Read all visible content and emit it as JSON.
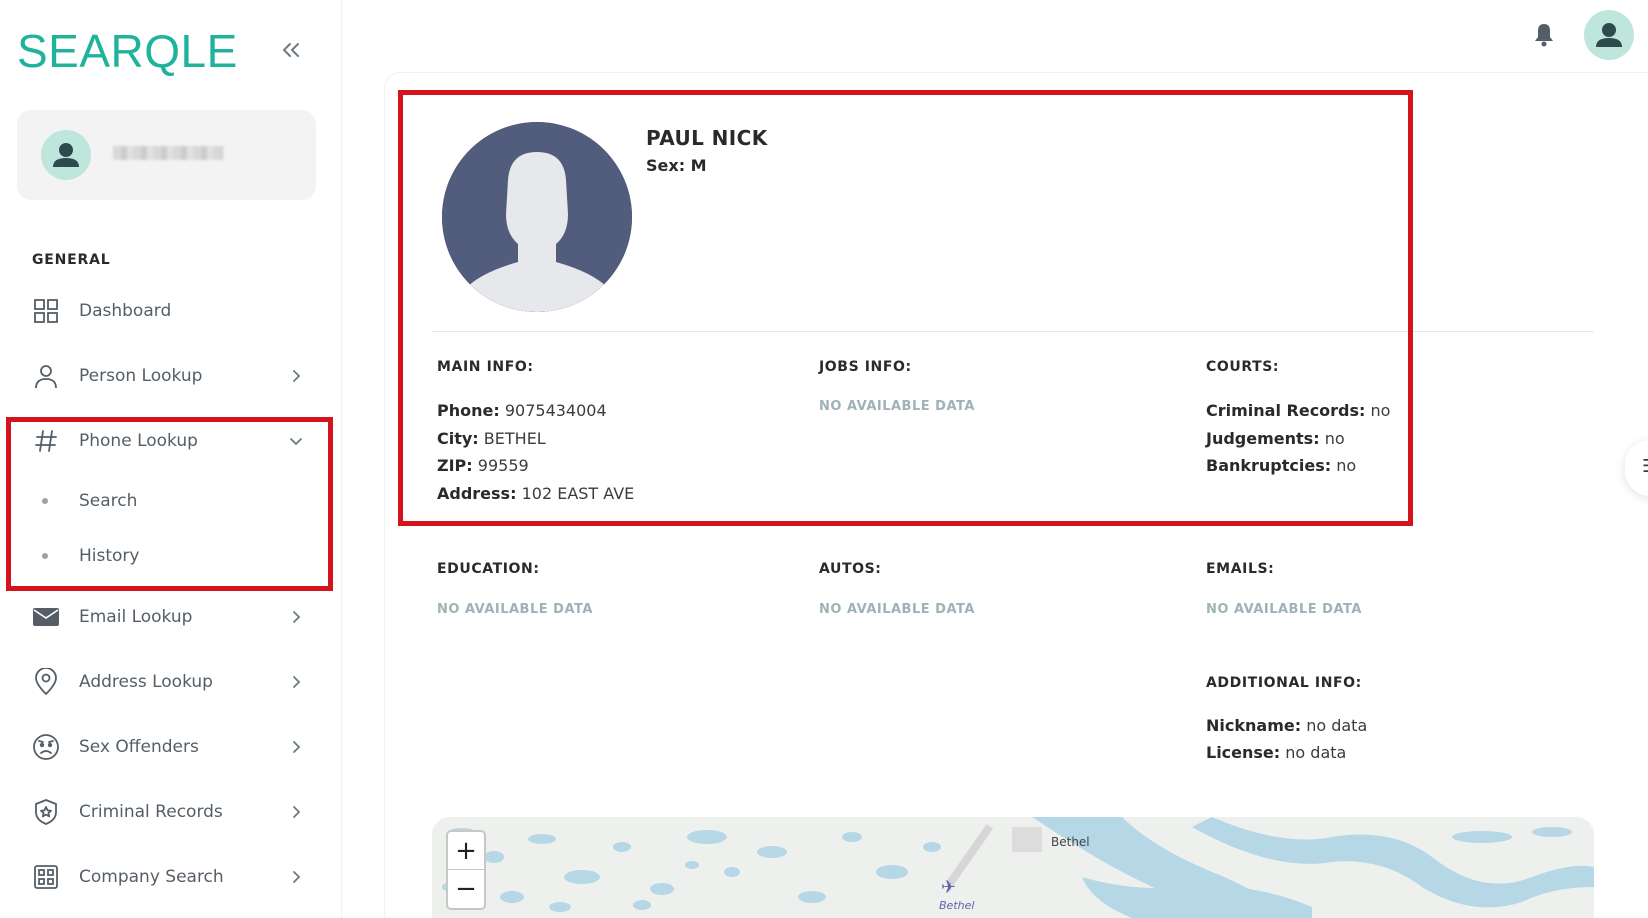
{
  "brand": {
    "logo": "SEARQLE",
    "accent": "#20b39b"
  },
  "sidebar": {
    "section_title": "GENERAL",
    "items": [
      {
        "label": "Dashboard",
        "icon": "grid-icon"
      },
      {
        "label": "Person Lookup",
        "icon": "person-icon"
      },
      {
        "label": "Phone Lookup",
        "icon": "hash-icon",
        "expanded": true,
        "subitems": [
          {
            "label": "Search"
          },
          {
            "label": "History"
          }
        ]
      },
      {
        "label": "Email Lookup",
        "icon": "envelope-icon"
      },
      {
        "label": "Address Lookup",
        "icon": "map-pin-icon"
      },
      {
        "label": "Sex Offenders",
        "icon": "face-icon"
      },
      {
        "label": "Criminal Records",
        "icon": "badge-icon"
      },
      {
        "label": "Company Search",
        "icon": "building-icon"
      }
    ]
  },
  "profile": {
    "name": "PAUL NICK",
    "sex_label": "Sex:",
    "sex_value": "M"
  },
  "main_info": {
    "title": "MAIN INFO:",
    "phone_label": "Phone:",
    "phone_value": "9075434004",
    "city_label": "City:",
    "city_value": "BETHEL",
    "zip_label": "ZIP:",
    "zip_value": "99559",
    "address_label": "Address:",
    "address_value": "102 EAST AVE"
  },
  "jobs_info": {
    "title": "JOBS INFO:",
    "value": "NO AVAILABLE DATA"
  },
  "courts": {
    "title": "COURTS:",
    "criminal_label": "Criminal Records:",
    "criminal_value": "no",
    "judgements_label": "Judgements:",
    "judgements_value": "no",
    "bankruptcies_label": "Bankruptcies:",
    "bankruptcies_value": "no"
  },
  "education": {
    "title": "EDUCATION:",
    "value": "NO AVAILABLE DATA"
  },
  "autos": {
    "title": "AUTOS:",
    "value": "NO AVAILABLE DATA"
  },
  "emails": {
    "title": "EMAILS:",
    "value": "NO AVAILABLE DATA"
  },
  "additional_info": {
    "title": "ADDITIONAL INFO:",
    "nickname_label": "Nickname:",
    "nickname_value": "no data",
    "license_label": "License:",
    "license_value": "no data"
  },
  "map": {
    "zoom_in": "+",
    "zoom_out": "−",
    "label_city": "Bethel",
    "label_airport": "Bethel",
    "water_color": "#b5d7e6",
    "land_color": "#eef0ee"
  },
  "colors": {
    "highlight": "#d4141c",
    "no_data": "#9fb2b8"
  }
}
